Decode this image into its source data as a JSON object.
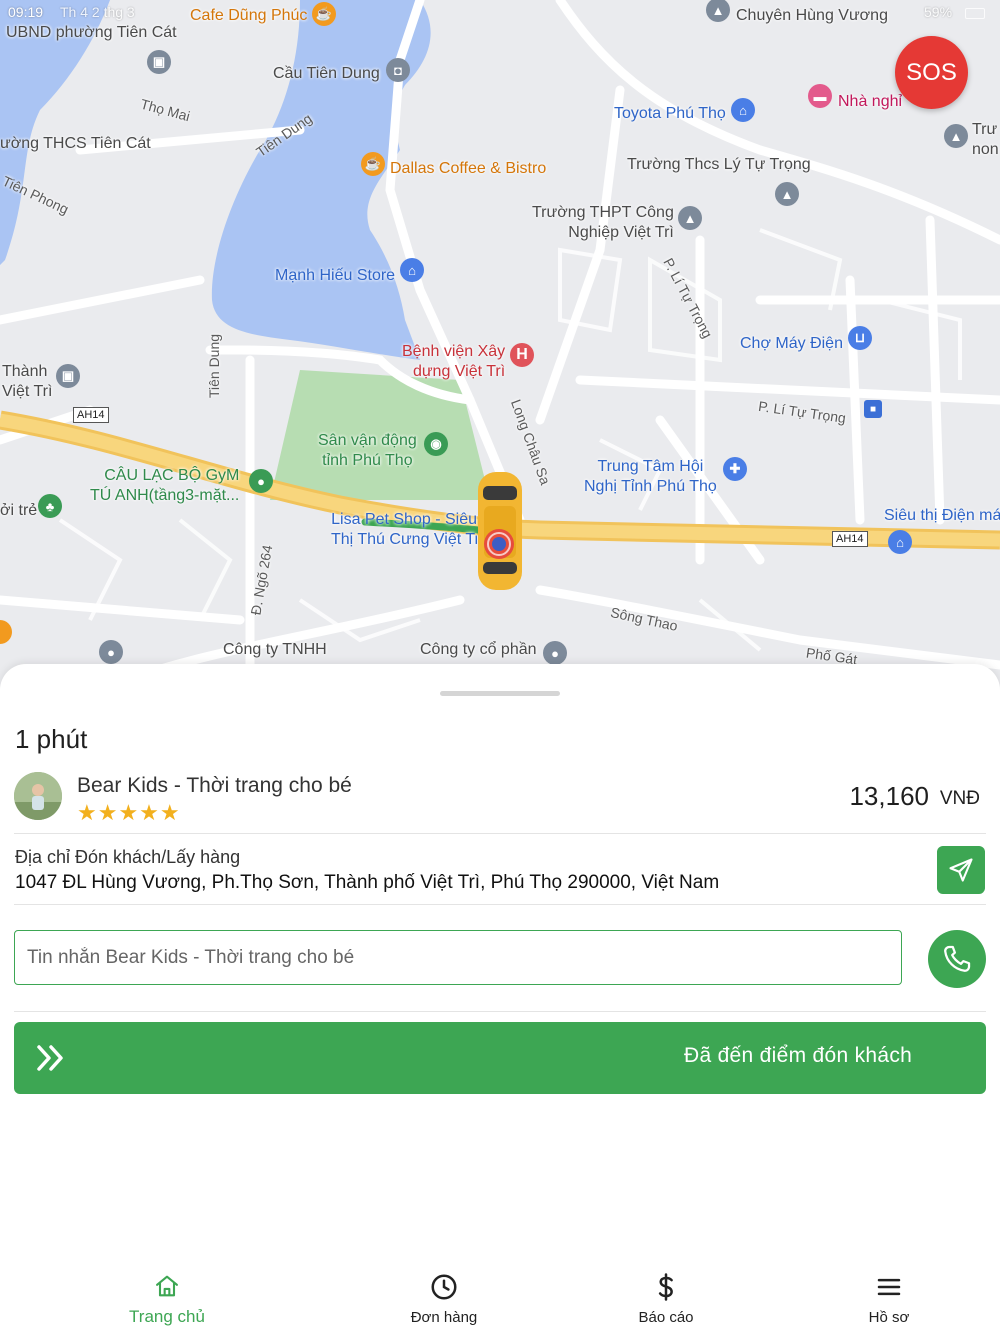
{
  "status_bar": {
    "time": "09:19",
    "day": "Th 4 2 thg 3",
    "battery": "59%"
  },
  "map": {
    "labels": {
      "ubnd": "UBND phường Tiên Cát",
      "cafe_dung_phuc": "Cafe Dũng Phúc",
      "chuyen_hung_vuong": "Chuyên Hùng Vương",
      "cau_tien_dung": "Cầu Tiên Dung",
      "tho_mai": "Thọ Mai",
      "tien_dung_rd": "Tiên Dung",
      "thcs_tien_cat": "ường THCS Tiên Cát",
      "tien_phong": "Tiên Phong",
      "toyota": "Toyota Phú Thọ",
      "nha_nghi": "Nhà nghỉ",
      "tru_non": "Trư\nnon",
      "dallas": "Dallas Coffee & Bistro",
      "thcs_ly_tu_trong": "Trường Thcs Lý Tự Trọng",
      "thpt_cong_nghiep": "Trường THPT Công\nNghiệp Việt Trì",
      "p_li_tu_trong": "P. Lí Tự Trọng",
      "manh_hieu": "Mạnh Hiếu Store",
      "cho_may_dien": "Chợ Máy Điện",
      "benh_vien": "Bệnh viện Xây\ndựng Việt Trì",
      "thanh_viet_tri": "Thành\nViệt Trì",
      "tien_dung_rd2": "Tiên Dung",
      "ah14_a": "AH14",
      "p_li_tu_trong2": "P. Lí Tự Trọng",
      "long_chau_sa": "Long Châu Sa",
      "san_van_dong": "Sân vận động\ntỉnh Phú Thọ",
      "trung_tam_hoi_nghi": "Trung Tâm Hội\nNghị Tỉnh Phú Thọ",
      "clb_gym": "CÂU LẠC BỘ GyM\nTÚ ANH(tầng3-mặt...",
      "oi_tre": "ởi trẻ",
      "lisa_pet": "Lisa Pet Shop - Siêu\nThị Thú Cưng Việt Trì",
      "sieu_thi_dien_may": "Siêu thị Điện má",
      "ah14_b": "AH14",
      "d_ngo_264": "Đ. Ngõ 264",
      "song_thao": "Sông Thao",
      "cong_ty_tnhh": "Công ty TNHH",
      "cong_ty_co_phan": "Công ty cổ phần",
      "pho_gat": "Phố Gát"
    }
  },
  "sos_label": "SOS",
  "trip": {
    "eta": "1 phút",
    "customer_name": "Bear Kids - Thời trang cho bé",
    "rating_stars": "★★★★★",
    "rating": 5,
    "price": "13,160",
    "currency": "VNĐ",
    "pickup_label": "Địa chỉ Đón khách/Lấy hàng",
    "pickup_address": "1047 ĐL Hùng Vương, Ph.Thọ Sơn, Thành phố Việt Trì, Phú Thọ 290000, Việt Nam",
    "message_placeholder": "Tin nhắn Bear Kids - Thời trang cho bé",
    "message_value": "",
    "arrive_button": "Đã đến điểm đón khách"
  },
  "tabs": {
    "home": "Trang chủ",
    "orders": "Đơn hàng",
    "report": "Báo cáo",
    "profile": "Hồ sơ"
  },
  "colors": {
    "primary": "#3da653",
    "sos": "#e53935",
    "water": "#aac4f3",
    "park": "#b5dcb2",
    "highway": "#f6cf6a"
  }
}
